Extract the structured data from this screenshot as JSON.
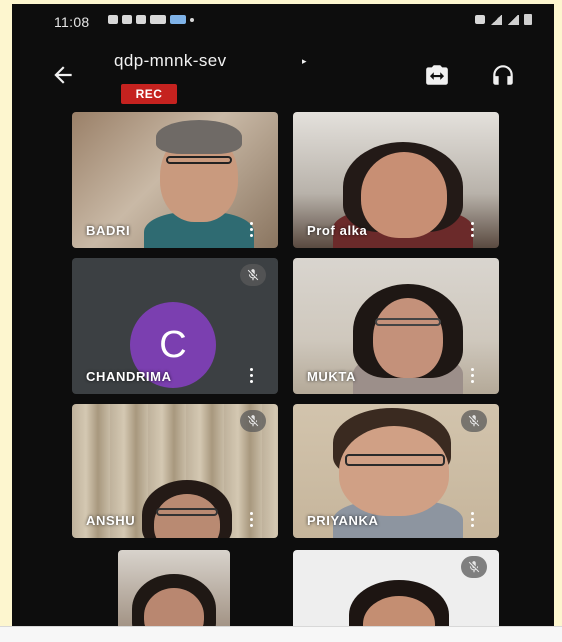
{
  "status_bar": {
    "time": "11:08"
  },
  "meeting": {
    "title": "qdp-mnnk-sev",
    "caret": "▸",
    "rec_label": "REC"
  },
  "participants": [
    {
      "name": "BADRI"
    },
    {
      "name": "Prof alka"
    },
    {
      "name": "CHANDRIMA",
      "avatar_letter": "C",
      "avatar_color": "#7b3fb0"
    },
    {
      "name": "MUKTA"
    },
    {
      "name": "ANSHU"
    },
    {
      "name": "PRIYANKA"
    },
    {
      "name": ""
    },
    {
      "name": ""
    }
  ],
  "colors": {
    "rec": "#c5221f",
    "tile_bg": "#3c4043",
    "screen_bg": "#0d0d0d",
    "outer_bg": "#fdf6cf"
  },
  "icons": [
    "back-arrow-icon",
    "switch-camera-icon",
    "headphones-icon",
    "more-vert-icon",
    "mic-off-icon"
  ]
}
